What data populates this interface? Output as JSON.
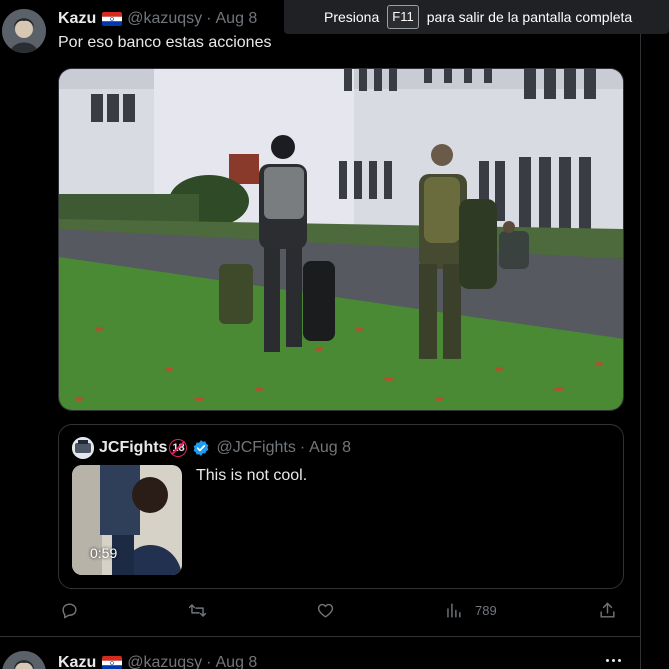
{
  "fullscreen_banner": {
    "prefix": "Presiona",
    "key": "F11",
    "suffix": "para salir de la pantalla completa"
  },
  "tweet": {
    "author_name": "Kazu",
    "handle": "@kazuqsy",
    "separator": "·",
    "date": "Aug 8",
    "text": "Por eso banco estas acciones",
    "quote": {
      "author_name": "JCFights",
      "badge": "18",
      "handle": "@JCFights",
      "separator": "·",
      "date": "Aug 8",
      "text": "This is not cool.",
      "video_duration": "0:59"
    },
    "actions": {
      "views": "789"
    }
  },
  "next_tweet": {
    "author_name": "Kazu",
    "handle": "@kazuqsy",
    "separator": "·",
    "date": "Aug 8"
  },
  "colors": {
    "background": "#000000",
    "text_primary": "#e7e9ea",
    "text_secondary": "#71767b",
    "border": "#2f3336",
    "verified_blue": "#1d9bf0"
  },
  "icons": [
    "reply-icon",
    "retweet-icon",
    "like-icon",
    "views-icon",
    "share-icon",
    "verified-icon",
    "more-icon"
  ]
}
